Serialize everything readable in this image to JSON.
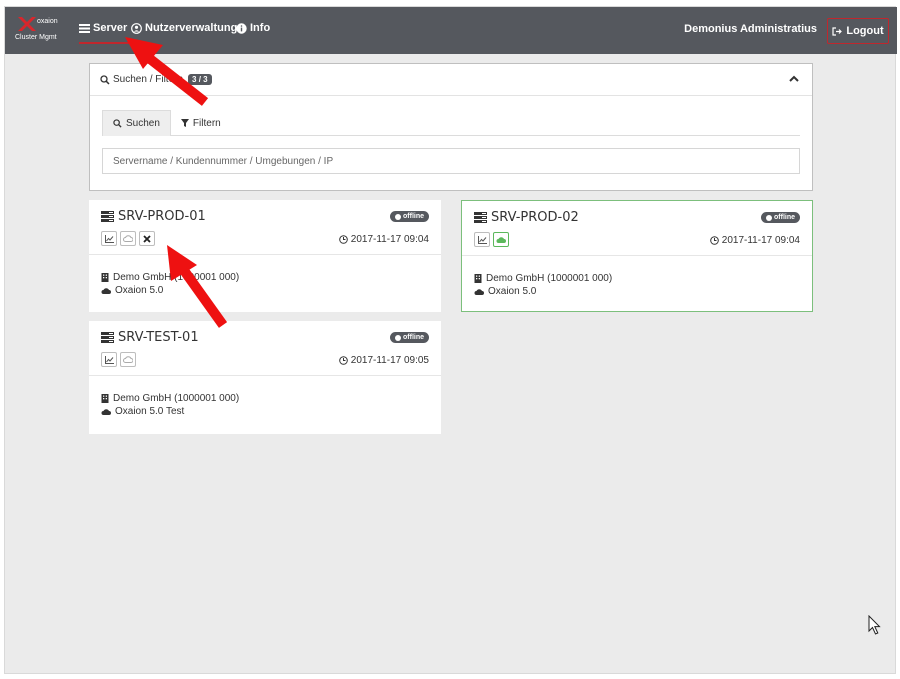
{
  "brand": {
    "name": "oxaion",
    "subtitle": "Cluster Mgmt"
  },
  "nav": {
    "items": [
      {
        "label": "Server",
        "icon": "server-icon",
        "active": true
      },
      {
        "label": "Nutzerverwaltung",
        "icon": "user-circle-icon"
      },
      {
        "label": "Info",
        "icon": "info-circle-icon"
      }
    ],
    "user_name": "Demonius Administratius",
    "logout_label": "Logout"
  },
  "search_panel": {
    "title": "Suchen / Filtern",
    "count": "3 / 3",
    "tabs": [
      {
        "label": "Suchen",
        "icon": "search-icon",
        "active": true
      },
      {
        "label": "Filtern",
        "icon": "filter-icon"
      }
    ],
    "placeholder": "Servername / Kundennummer / Umgebungen / IP"
  },
  "servers": [
    {
      "name": "SRV-PROD-01",
      "status": "offline",
      "timestamp": "2017-11-17 09:04",
      "customer": "Demo GmbH (1000001 000)",
      "environment": "Oxaion 5.0"
    },
    {
      "name": "SRV-PROD-02",
      "status": "offline",
      "timestamp": "2017-11-17 09:04",
      "customer": "Demo GmbH (1000001 000)",
      "environment": "Oxaion 5.0"
    },
    {
      "name": "SRV-TEST-01",
      "status": "offline",
      "timestamp": "2017-11-17 09:05",
      "customer": "Demo GmbH (1000001 000)",
      "environment": "Oxaion 5.0 Test"
    }
  ],
  "colors": {
    "navbar": "#55585e",
    "accent": "#c0272d",
    "annotation_arrow": "#ee1111",
    "online_green": "#5cb85c"
  }
}
